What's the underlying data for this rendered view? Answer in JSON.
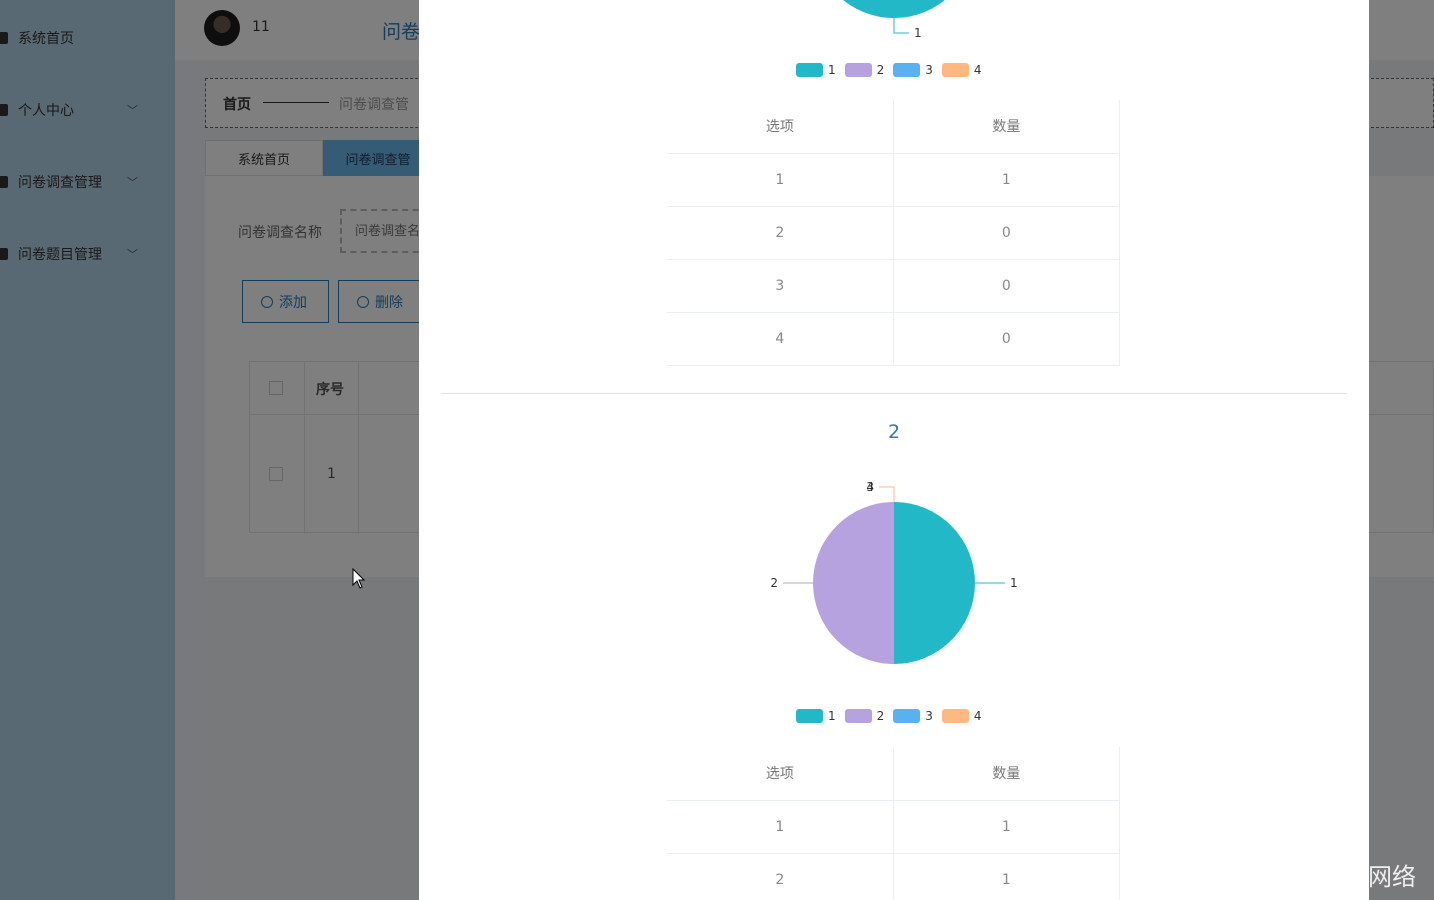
{
  "sidebar": {
    "items": [
      {
        "label": "系统首页",
        "has_arrow": false
      },
      {
        "label": "个人中心",
        "has_arrow": true
      },
      {
        "label": "问卷调查管理",
        "has_arrow": true
      },
      {
        "label": "问卷题目管理",
        "has_arrow": true
      }
    ]
  },
  "header": {
    "username": "11",
    "title": "问卷"
  },
  "breadcrumb": {
    "home": "首页",
    "current": "问卷调查管"
  },
  "tabs": [
    {
      "label": "系统首页",
      "active": false
    },
    {
      "label": "问卷调查管",
      "active": true
    }
  ],
  "search": {
    "label": "问卷调查名称",
    "placeholder": "问卷调查名"
  },
  "buttons": {
    "add": "添加",
    "delete": "删除"
  },
  "list_table": {
    "header_seq": "序号",
    "rows": [
      {
        "seq": "1"
      }
    ]
  },
  "dialog": {
    "colors": [
      "#22b8c8",
      "#b6a2de",
      "#5ab1ef",
      "#ffb980"
    ],
    "table_headers": [
      "选项",
      "数量"
    ]
  },
  "chart_data": [
    {
      "type": "pie",
      "title": "",
      "legend": [
        "1",
        "2",
        "3",
        "4"
      ],
      "legend_position": "bottom",
      "slices": [
        {
          "label": "1",
          "value": 1
        },
        {
          "label": "2",
          "value": 0
        },
        {
          "label": "3",
          "value": 0
        },
        {
          "label": "4",
          "value": 0
        }
      ]
    },
    {
      "type": "pie",
      "title": "2",
      "legend": [
        "1",
        "2",
        "3",
        "4"
      ],
      "legend_position": "bottom",
      "slices": [
        {
          "label": "1",
          "value": 1
        },
        {
          "label": "2",
          "value": 1
        },
        {
          "label": "3",
          "value": 0
        },
        {
          "label": "4",
          "value": 0
        }
      ]
    }
  ],
  "watermark": "CSDN @磐石网络"
}
